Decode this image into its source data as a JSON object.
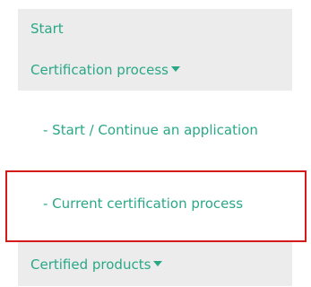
{
  "nav": {
    "start_label": "Start",
    "cert_process_label": "Certification process",
    "start_continue_label": "- Start / Continue an application",
    "current_process_label": "- Current certification process",
    "certified_products_label": "Certified products"
  },
  "icons": {
    "dropdown": "caret-down-icon"
  },
  "colors": {
    "link": "#2aa886",
    "menu_bg": "#ececec",
    "highlight": "#d51a1a"
  }
}
